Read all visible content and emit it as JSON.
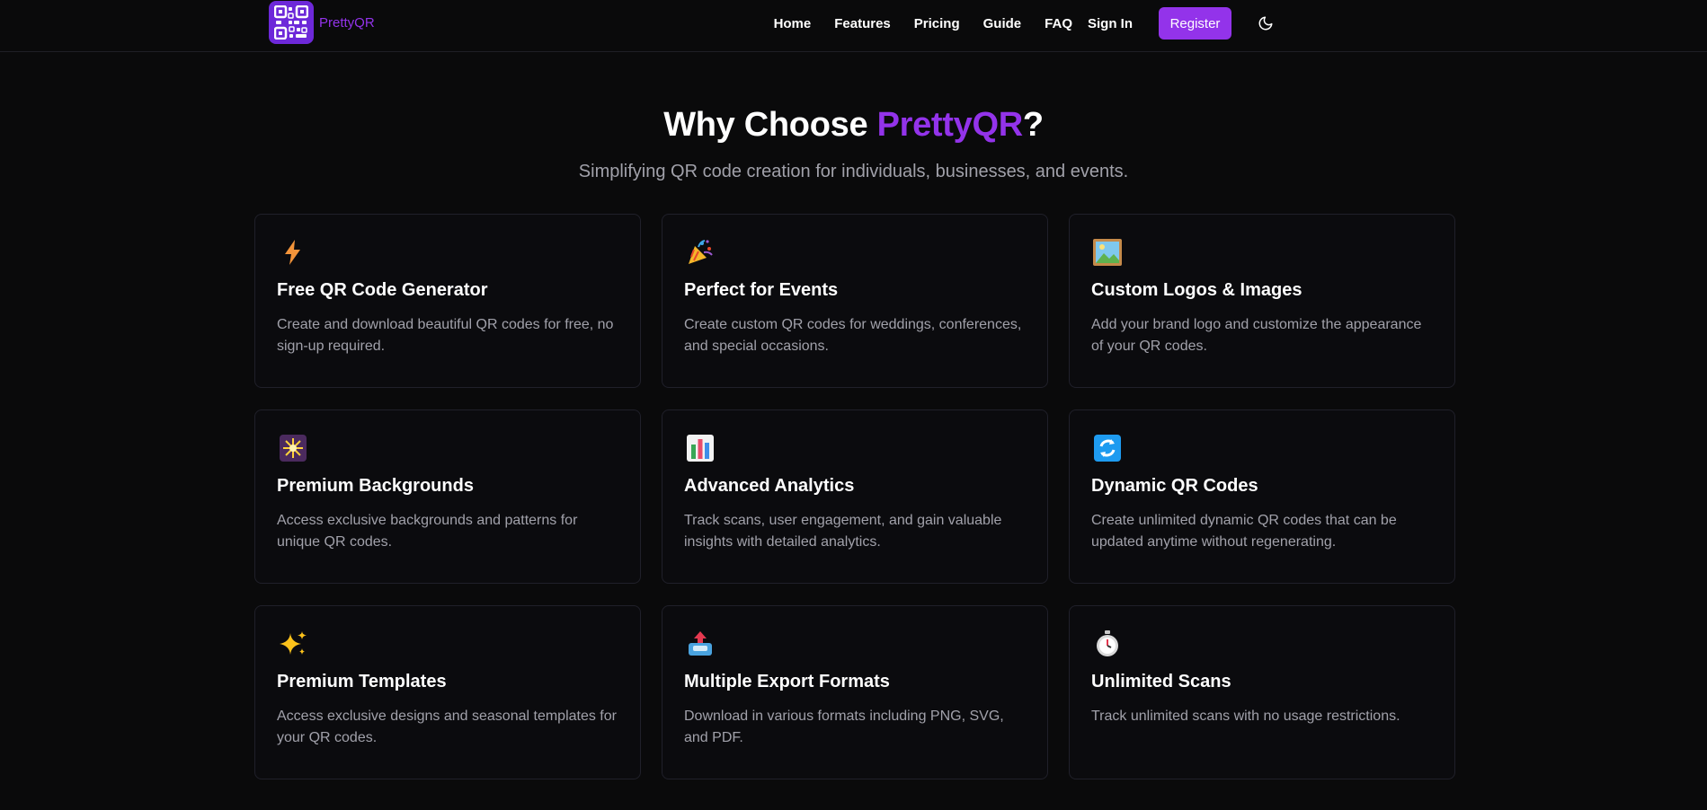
{
  "nav": {
    "brand": "PrettyQR",
    "links": [
      "Home",
      "Features",
      "Pricing",
      "Guide",
      "FAQ"
    ],
    "signin": "Sign In",
    "register": "Register",
    "theme_icon": "moon-icon"
  },
  "section": {
    "title_prefix": "Why Choose ",
    "title_accent": "PrettyQR",
    "title_suffix": "?",
    "subtitle": "Simplifying QR code creation for individuals, businesses, and events."
  },
  "features": [
    {
      "icon": "lightning-icon",
      "title": "Free QR Code Generator",
      "desc": "Create and download beautiful QR codes for free, no sign-up required."
    },
    {
      "icon": "party-popper-icon",
      "title": "Perfect for Events",
      "desc": "Create custom QR codes for weddings, conferences, and special occasions."
    },
    {
      "icon": "framed-picture-icon",
      "title": "Custom Logos & Images",
      "desc": "Add your brand logo and customize the appearance of your QR codes."
    },
    {
      "icon": "sparkler-icon",
      "title": "Premium Backgrounds",
      "desc": "Access exclusive backgrounds and patterns for unique QR codes."
    },
    {
      "icon": "bar-chart-icon",
      "title": "Advanced Analytics",
      "desc": "Track scans, user engagement, and gain valuable insights with detailed analytics."
    },
    {
      "icon": "refresh-icon",
      "title": "Dynamic QR Codes",
      "desc": "Create unlimited dynamic QR codes that can be updated anytime without regenerating."
    },
    {
      "icon": "sparkles-icon",
      "title": "Premium Templates",
      "desc": "Access exclusive designs and seasonal templates for your QR codes."
    },
    {
      "icon": "outbox-tray-icon",
      "title": "Multiple Export Formats",
      "desc": "Download in various formats including PNG, SVG, and PDF."
    },
    {
      "icon": "stopwatch-icon",
      "title": "Unlimited Scans",
      "desc": "Track unlimited scans with no usage restrictions."
    }
  ],
  "colors": {
    "accent": "#9333ea",
    "background": "#0a0a0b",
    "muted_text": "#a1a1aa",
    "card_border": "#20202a"
  }
}
